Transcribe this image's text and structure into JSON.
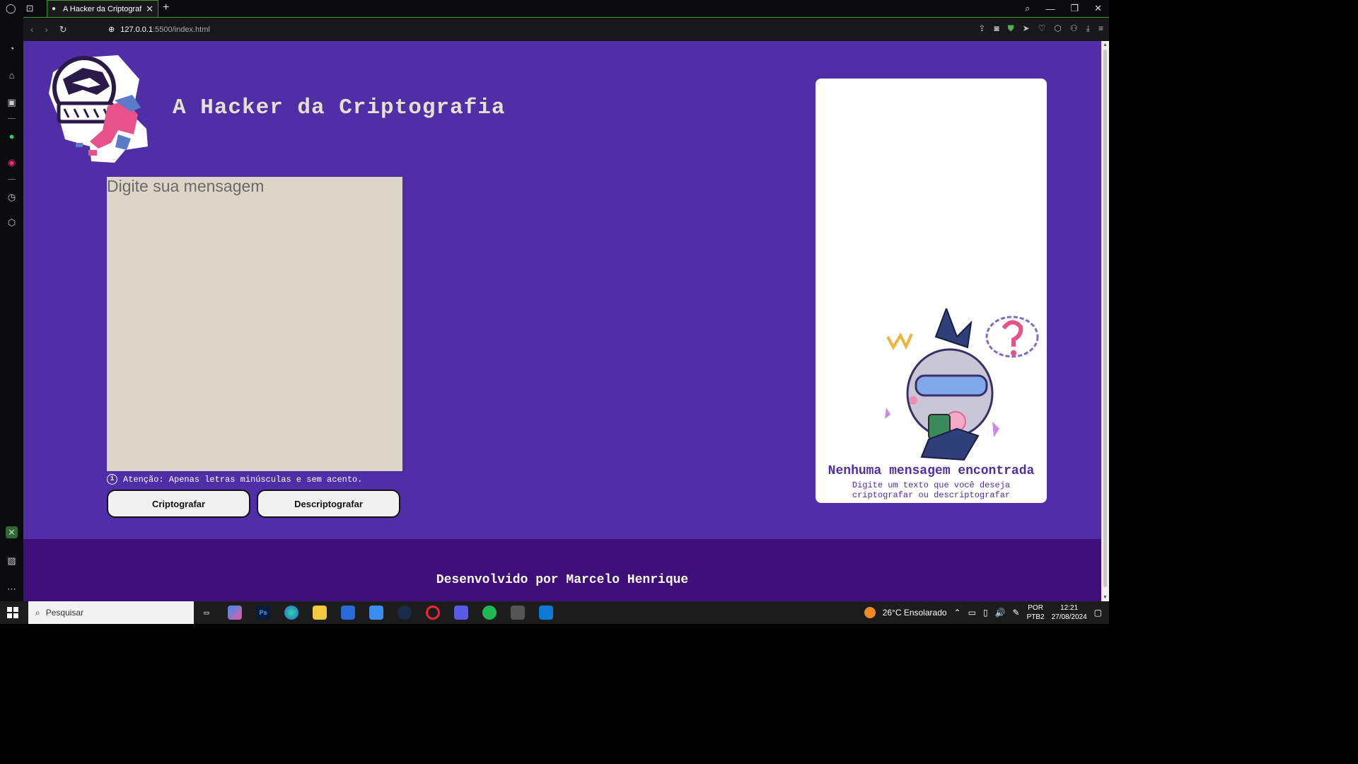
{
  "browser": {
    "tab_title": "A Hacker da Criptografia",
    "url_host": "127.0.0.1",
    "url_path": ":5500/index.html"
  },
  "page": {
    "title": "A Hacker da Criptografia",
    "input_placeholder": "Digite sua mensagem",
    "warning": "Atenção: Apenas letras minúsculas e sem acento.",
    "encrypt_button": "Criptografar",
    "decrypt_button": "Descriptografar",
    "output_title": "Nenhuma mensagem encontrada",
    "output_subtitle": "Digite um texto que você deseja criptografar ou descriptografar",
    "footer": "Desenvolvido por Marcelo Henrique"
  },
  "taskbar": {
    "search_placeholder": "Pesquisar",
    "weather": "26°C  Ensolarado",
    "lang_1": "POR",
    "lang_2": "PTB2",
    "time": "12:21",
    "date": "27/08/2024"
  },
  "colors": {
    "page_bg": "#4f2ea8",
    "footer_bg": "#3e0f78",
    "input_bg": "#ddd6c8",
    "title_color": "#e6e0d0"
  }
}
